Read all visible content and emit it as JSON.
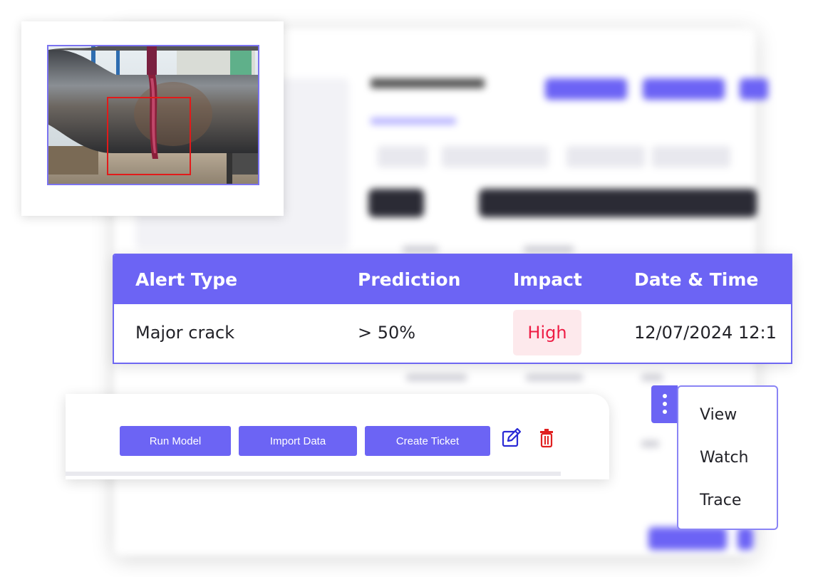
{
  "alert_table": {
    "columns": [
      "Alert Type",
      "Prediction",
      "Impact",
      "Date & Time"
    ],
    "row": {
      "alert_type": "Major crack",
      "prediction": "> 50%",
      "impact": "High",
      "date_time": "12/07/2024 12:1"
    }
  },
  "toolbar": {
    "run_model_label": "Run Model",
    "import_data_label": "Import Data",
    "create_ticket_label": "Create Ticket"
  },
  "menu": {
    "items": [
      "View",
      "Watch",
      "Trace"
    ]
  },
  "icons": [
    "edit-icon",
    "trash-icon",
    "kebab-menu-icon"
  ],
  "colors": {
    "accent": "#6c64f4",
    "impact_high_text": "#ee1d45",
    "impact_high_bg": "#fde9ec",
    "detection_box": "#e21a1a",
    "edit_icon": "#2a2ad6",
    "delete_icon": "#e02020"
  }
}
